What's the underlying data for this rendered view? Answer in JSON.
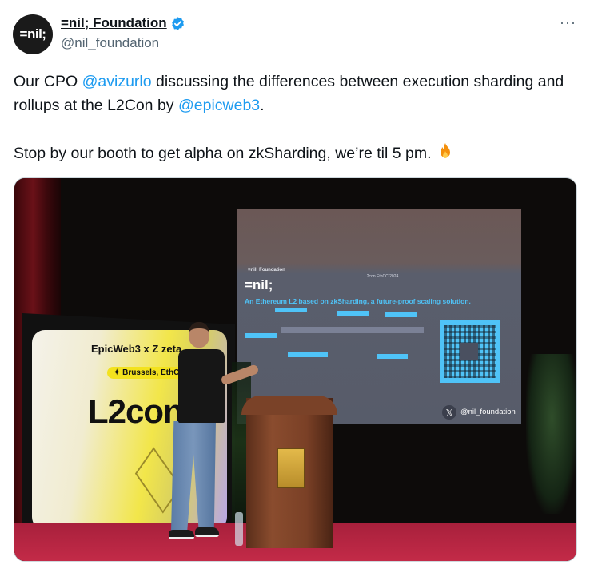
{
  "author": {
    "avatar_text": "=nil;",
    "name": "=nil; Foundation",
    "handle": "@nil_foundation",
    "verified": true
  },
  "more_label": "···",
  "tweet": {
    "line1_pre": "Our CPO ",
    "mention1": "@avizurlo",
    "line1_post": " discussing the differences between execution sharding and rollups at the L2Con by ",
    "mention2": "@epicweb3",
    "line1_end": ".",
    "line2": "Stop by our booth to get alpha on zkSharding, we’re til 5 pm. ",
    "emoji": "fire-emoji"
  },
  "photo": {
    "slide": {
      "org": "=nil; Foundation",
      "event": "L2con EthCC 2024",
      "logo": "=nil;",
      "subtitle": "An Ethereum L2 based on zkSharding, a future-proof scaling solution.",
      "handle": "@nil_foundation"
    },
    "banner": {
      "brand": "EpicWeb3 x Z zeta",
      "pill": "✦ Brussels, EthCC",
      "title": "L2con"
    }
  },
  "colors": {
    "link": "#1d9bf0",
    "verified": "#1d9bf0",
    "secondary": "#536471"
  }
}
